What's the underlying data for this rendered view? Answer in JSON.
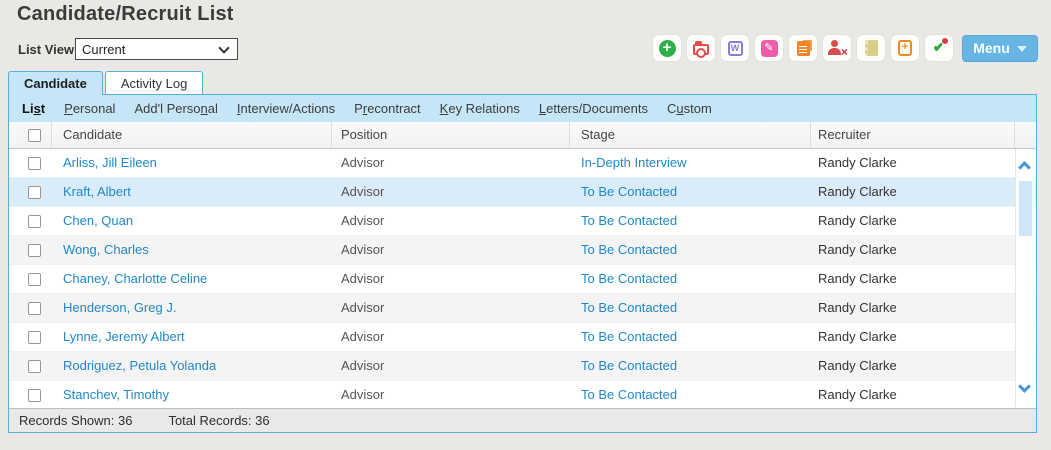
{
  "page": {
    "title": "Candidate/Recruit List"
  },
  "list_view": {
    "label": "List View",
    "value": "Current"
  },
  "toolbar": {
    "menu_label": "Menu",
    "icons": [
      "add-icon",
      "folder-record-icon",
      "word-document-icon",
      "edit-icon",
      "copy-documents-icon",
      "remove-person-icon",
      "notepad-icon",
      "add-document-icon",
      "key-check-icon"
    ]
  },
  "tabs": [
    {
      "label": "Candidate",
      "active": true
    },
    {
      "label": "Activity Log",
      "active": false
    }
  ],
  "nav": {
    "items": [
      {
        "pre": "Li",
        "key": "s",
        "post": "t",
        "active": true
      },
      {
        "pre": "",
        "key": "P",
        "post": "ersonal"
      },
      {
        "pre": "Add'l Perso",
        "key": "n",
        "post": "al"
      },
      {
        "pre": "",
        "key": "I",
        "post": "nterview/Actions"
      },
      {
        "pre": "P",
        "key": "r",
        "post": "econtract"
      },
      {
        "pre": "",
        "key": "K",
        "post": "ey Relations"
      },
      {
        "pre": "",
        "key": "L",
        "post": "etters/Documents"
      },
      {
        "pre": "C",
        "key": "u",
        "post": "stom"
      }
    ]
  },
  "table": {
    "columns": [
      "Candidate",
      "Position",
      "Stage",
      "Recruiter"
    ],
    "rows": [
      {
        "candidate": "Arliss, Jill Eileen",
        "position": "Advisor",
        "stage": "In-Depth Interview",
        "recruiter": "Randy Clarke",
        "highlighted": false
      },
      {
        "candidate": "Kraft, Albert",
        "position": "Advisor",
        "stage": "To Be Contacted",
        "recruiter": "Randy Clarke",
        "highlighted": true
      },
      {
        "candidate": "Chen, Quan",
        "position": "Advisor",
        "stage": "To Be Contacted",
        "recruiter": "Randy Clarke",
        "highlighted": false
      },
      {
        "candidate": "Wong, Charles",
        "position": "Advisor",
        "stage": "To Be Contacted",
        "recruiter": "Randy Clarke",
        "highlighted": false
      },
      {
        "candidate": "Chaney, Charlotte Celine",
        "position": "Advisor",
        "stage": "To Be Contacted",
        "recruiter": "Randy Clarke",
        "highlighted": false
      },
      {
        "candidate": "Henderson, Greg J.",
        "position": "Advisor",
        "stage": "To Be Contacted",
        "recruiter": "Randy Clarke",
        "highlighted": false
      },
      {
        "candidate": "Lynne, Jeremy Albert",
        "position": "Advisor",
        "stage": "To Be Contacted",
        "recruiter": "Randy Clarke",
        "highlighted": false
      },
      {
        "candidate": "Rodriguez, Petula Yolanda",
        "position": "Advisor",
        "stage": "To Be Contacted",
        "recruiter": "Randy Clarke",
        "highlighted": false
      },
      {
        "candidate": "Stanchev, Timothy",
        "position": "Advisor",
        "stage": "To Be Contacted",
        "recruiter": "Randy Clarke",
        "highlighted": false
      }
    ]
  },
  "status": {
    "records_shown": "Records Shown: 36",
    "total_records": "Total Records: 36"
  },
  "colors": {
    "accent_border": "#55aede",
    "tab_fill": "#c5e6f6",
    "link": "#2187c8",
    "highlight_row": "#daecf9",
    "menu_button": "#66b5e3",
    "page_background": "#e9e8e5"
  }
}
